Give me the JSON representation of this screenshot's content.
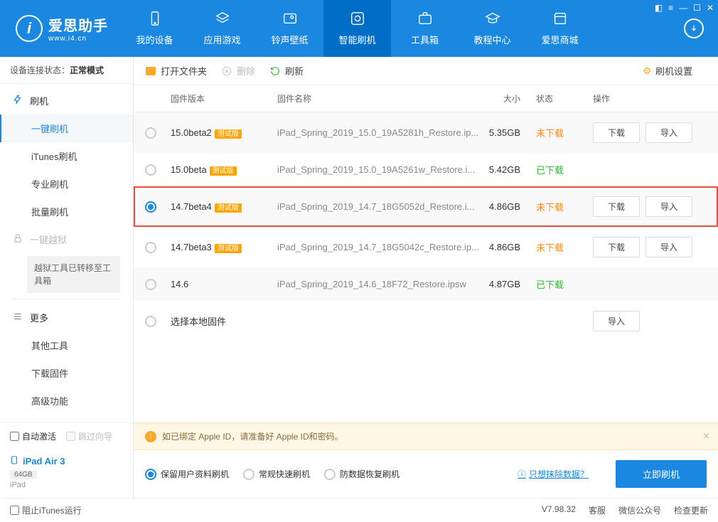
{
  "header": {
    "logo_title": "爱思助手",
    "logo_sub": "www.i4.cn",
    "nav": [
      {
        "label": "我的设备",
        "icon": "phone"
      },
      {
        "label": "应用游戏",
        "icon": "apps"
      },
      {
        "label": "铃声壁纸",
        "icon": "image"
      },
      {
        "label": "智能刷机",
        "icon": "refresh",
        "active": true
      },
      {
        "label": "工具箱",
        "icon": "briefcase"
      },
      {
        "label": "教程中心",
        "icon": "grad"
      },
      {
        "label": "爱思商城",
        "icon": "shop"
      }
    ]
  },
  "sidebar": {
    "status_label": "设备连接状态：",
    "status_mode": "正常模式",
    "flash_head": "刷机",
    "items": [
      "一键刷机",
      "iTunes刷机",
      "专业刷机",
      "批量刷机"
    ],
    "jailbreak_head": "一键越狱",
    "jailbreak_note": "越狱工具已转移至工具箱",
    "more_head": "更多",
    "more_items": [
      "其他工具",
      "下载固件",
      "高级功能"
    ],
    "auto_activate": "自动激活",
    "skip_guide": "跳过向导",
    "device_name": "iPad Air 3",
    "device_storage": "64GB",
    "device_caption": "iPad"
  },
  "toolbar": {
    "open_folder": "打开文件夹",
    "delete": "删除",
    "refresh": "刷新",
    "settings": "刷机设置"
  },
  "table": {
    "head": {
      "version": "固件版本",
      "name": "固件名称",
      "size": "大小",
      "status": "状态",
      "action": "操作"
    },
    "rows": [
      {
        "version": "15.0beta2",
        "beta": true,
        "name": "iPad_Spring_2019_15.0_19A5281h_Restore.ip...",
        "size": "5.35GB",
        "status": "未下载",
        "status_type": "nd",
        "download": true,
        "import": true,
        "selected": false
      },
      {
        "version": "15.0beta",
        "beta": true,
        "name": "iPad_Spring_2019_15.0_19A5261w_Restore.i...",
        "size": "5.42GB",
        "status": "已下载",
        "status_type": "dl",
        "download": false,
        "import": false,
        "selected": false
      },
      {
        "version": "14.7beta4",
        "beta": true,
        "name": "iPad_Spring_2019_14.7_18G5052d_Restore.i...",
        "size": "4.86GB",
        "status": "未下载",
        "status_type": "nd",
        "download": true,
        "import": true,
        "selected": true,
        "highlighted": true
      },
      {
        "version": "14.7beta3",
        "beta": true,
        "name": "iPad_Spring_2019_14.7_18G5042c_Restore.ip...",
        "size": "4.86GB",
        "status": "未下载",
        "status_type": "nd",
        "download": true,
        "import": true,
        "selected": false
      },
      {
        "version": "14.6",
        "beta": false,
        "name": "iPad_Spring_2019_14.6_18F72_Restore.ipsw",
        "size": "4.87GB",
        "status": "已下载",
        "status_type": "dl",
        "download": false,
        "import": false,
        "selected": false
      },
      {
        "version": "选择本地固件",
        "beta": false,
        "name": "",
        "size": "",
        "status": "",
        "status_type": "",
        "download": false,
        "import": true,
        "selected": false
      }
    ],
    "beta_label": "测试版",
    "download_label": "下载",
    "import_label": "导入"
  },
  "warning": {
    "text": "如已绑定 Apple ID，请准备好 Apple ID和密码。"
  },
  "flash": {
    "opts": [
      "保留用户资料刷机",
      "常规快速刷机",
      "防数据恢复刷机"
    ],
    "link": "只想抹除数据？",
    "submit": "立即刷机"
  },
  "statusbar": {
    "block_itunes": "阻止iTunes运行",
    "version": "V7.98.32",
    "right": [
      "客服",
      "微信公众号",
      "检查更新"
    ]
  }
}
